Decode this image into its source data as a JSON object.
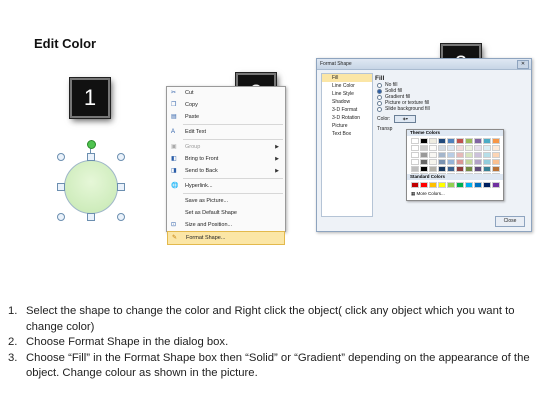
{
  "title": "Edit Color",
  "steps": {
    "one": "1",
    "two": "2",
    "three": "3"
  },
  "context_menu": {
    "items": [
      {
        "label": "Cut",
        "icon": "scissors-icon"
      },
      {
        "label": "Copy",
        "icon": "copy-icon"
      },
      {
        "label": "Paste",
        "icon": "paste-icon"
      },
      {
        "label": "Edit Text",
        "icon": "text-icon"
      },
      {
        "label": "Group",
        "icon": "group-icon"
      },
      {
        "label": "Bring to Front",
        "icon": "bring-front-icon"
      },
      {
        "label": "Send to Back",
        "icon": "send-back-icon"
      },
      {
        "label": "Hyperlink...",
        "icon": "link-icon"
      },
      {
        "label": "Save as Picture...",
        "icon": ""
      },
      {
        "label": "Set as Default Shape",
        "icon": ""
      },
      {
        "label": "Size and Position...",
        "icon": "size-icon"
      },
      {
        "label": "Format Shape...",
        "icon": "format-icon"
      }
    ]
  },
  "dialog": {
    "title": "Format Shape",
    "categories": [
      "Fill",
      "Line Color",
      "Line Style",
      "Shadow",
      "3-D Format",
      "3-D Rotation",
      "Picture",
      "Text Box"
    ],
    "fill_heading": "Fill",
    "options": [
      "No fill",
      "Solid fill",
      "Gradient fill",
      "Picture or texture fill",
      "Slide background fill"
    ],
    "color_label": "Color:",
    "transparency_label": "Transp",
    "close": "Close"
  },
  "picker": {
    "theme_heading": "Theme Colors",
    "standard_heading": "Standard Colors",
    "more": "More Colors...",
    "theme_top": [
      "#ffffff",
      "#000000",
      "#eeece1",
      "#1f497d",
      "#4f81bd",
      "#c0504d",
      "#9bbb59",
      "#8064a2",
      "#4bacc6",
      "#f79646"
    ],
    "standard": [
      "#c00000",
      "#ff0000",
      "#ffc000",
      "#ffff00",
      "#92d050",
      "#00b050",
      "#00b0f0",
      "#0070c0",
      "#002060",
      "#7030a0"
    ]
  },
  "instructions": [
    {
      "num": "1.",
      "text": "Select the shape to change the color and Right click the object( click any object which you want to change color)"
    },
    {
      "num": "2.",
      "text": "Choose Format Shape in the dialog box."
    },
    {
      "num": "3.",
      "text": "Choose “Fill” in the Format Shape box then “Solid” or “Gradient” depending on the appearance of the object. Change colour as shown in the picture."
    }
  ]
}
